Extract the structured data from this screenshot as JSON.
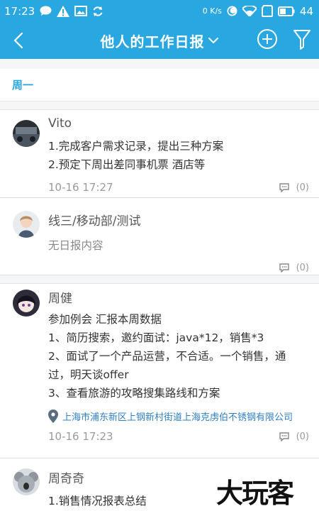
{
  "status_bar": {
    "time": "17:23",
    "network_speed": "0 K/s",
    "battery": "44"
  },
  "header": {
    "title": "他人的工作日报",
    "colors": {
      "bar": "#29a7e1",
      "accent": "#29a7e1"
    }
  },
  "section": {
    "weekday": "周一"
  },
  "reports": [
    {
      "name": "Vito",
      "lines": [
        "1.完成客户需求记录，提出三种方案",
        "2.预定下周出差同事机票 酒店等"
      ],
      "time": "10-16 17:27",
      "comments": "(0)"
    },
    {
      "name": "线三/移动部/测试",
      "empty_text": "无日报内容",
      "comments": "(0)"
    },
    {
      "name": "周健",
      "lines": [
        "参加例会 汇报本周数据",
        "1、简历搜索，邀约面试：java*12，销售*3",
        "2、面试了一个产品运营，不合适。一个销售，通",
        "过，明天谈offer",
        "3、查看旅游的攻略搜集路线和方案"
      ],
      "location": "上海市浦东新区上钢新村街道上海克虏伯不锈钢有限公司",
      "time": "10-16 17:23",
      "comments": "(0)"
    },
    {
      "name": "周奇奇",
      "lines": [
        "1.销售情况报表总结"
      ]
    }
  ],
  "watermark": "大玩客"
}
